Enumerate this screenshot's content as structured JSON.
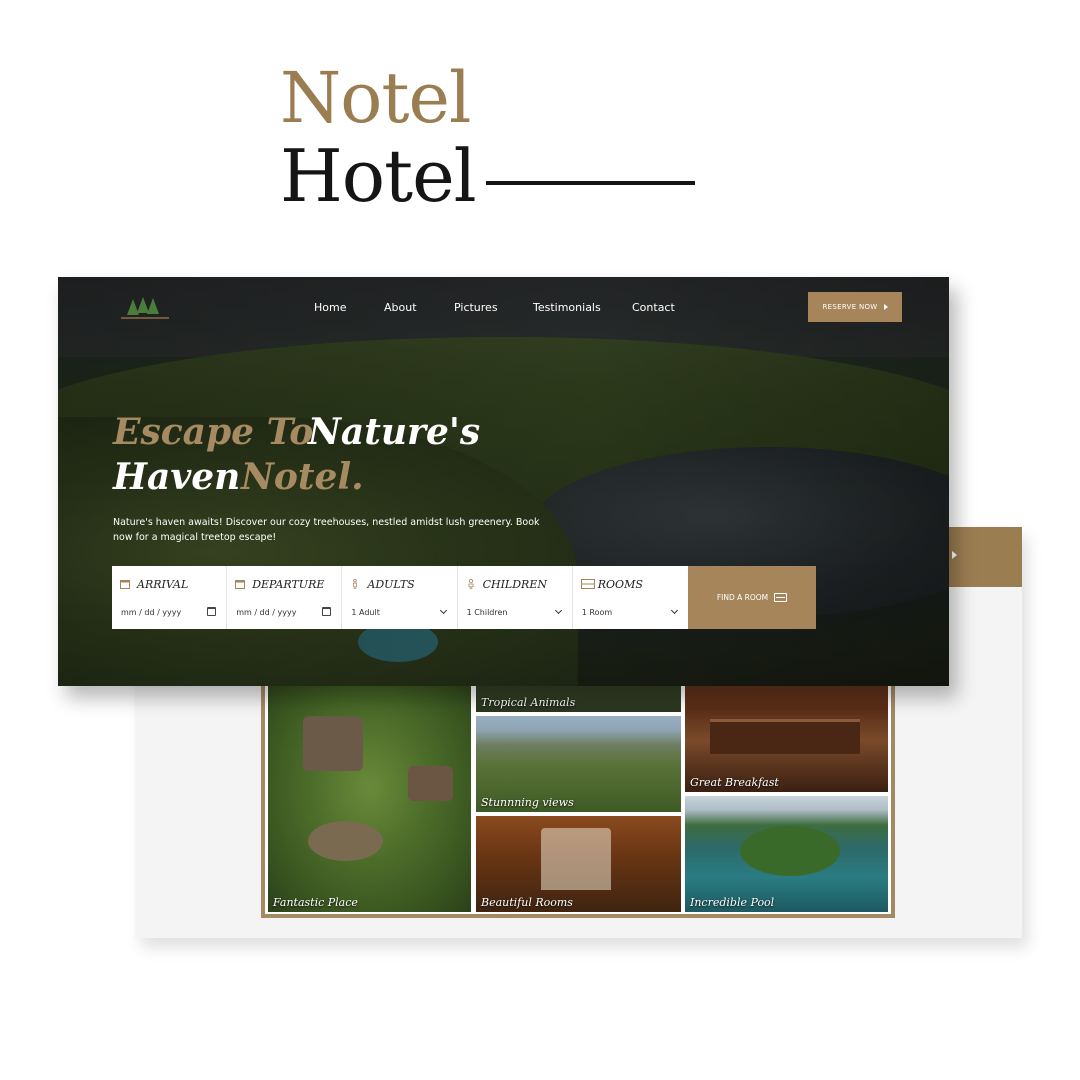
{
  "brand": {
    "line1": "Notel",
    "line2": "Hotel"
  },
  "nav": {
    "items": [
      "Home",
      "About",
      "Pictures",
      "Testimonials",
      "Contact"
    ],
    "reserve_label": "RESERVE NOW"
  },
  "hero": {
    "headline_parts": {
      "p1": "Escape To",
      "p2": "Nature's",
      "p3": "Haven",
      "p4": "Notel."
    },
    "description": "Nature's haven awaits! Discover our cozy treehouses, nestled amidst lush greenery. Book now for a magical treetop escape!"
  },
  "booking": {
    "fields": [
      {
        "label": "ARRIVAL",
        "value": "mm / dd / yyyy",
        "icon": "calendar-icon"
      },
      {
        "label": "DEPARTURE",
        "value": "mm / dd / yyyy",
        "icon": "calendar-icon"
      },
      {
        "label": "ADULTS",
        "value": "1 Adult",
        "icon": "adult-icon"
      },
      {
        "label": "CHILDREN",
        "value": "1 Children",
        "icon": "child-icon"
      },
      {
        "label": "ROOMS",
        "value": "1 Room",
        "icon": "bed-icon"
      }
    ],
    "find_label": "FIND A ROOM"
  },
  "gallery": {
    "captions": [
      "Tropical Animals",
      "Great Breakfast",
      "Stunnning views",
      "Fantastic Place",
      "Beautiful Rooms",
      "Incredible Pool"
    ]
  },
  "colors": {
    "gold": "#a7855a",
    "brand_gold": "#9b7d52",
    "dark": "#151515"
  }
}
